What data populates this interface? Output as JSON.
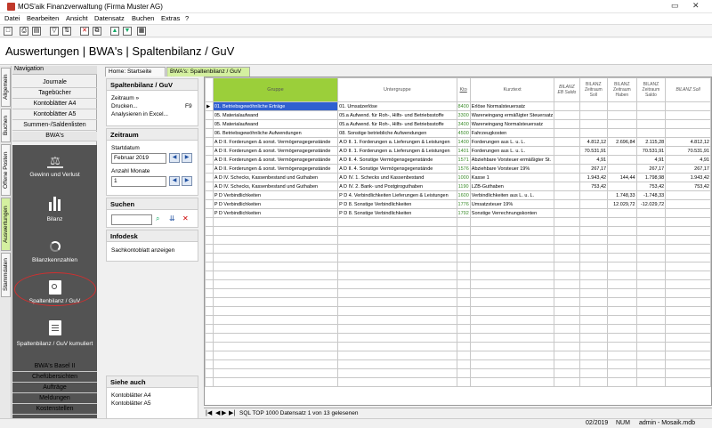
{
  "window": {
    "title": "MOS'aik Finanzverwaltung (Firma Muster AG)"
  },
  "menu": [
    "Datei",
    "Bearbeiten",
    "Ansicht",
    "Datensatz",
    "Buchen",
    "Extras",
    "?"
  ],
  "app_title": "Auswertungen | BWA's | Spaltenbilanz / GuV",
  "side_tabs": [
    "Allgemein",
    "Buchen",
    "Offene Posten",
    "Auswertungen",
    "Stammdaten"
  ],
  "nav": {
    "header": "Navigation",
    "top_items": [
      "Journale",
      "Tagebücher",
      "Kontoblätter A4",
      "Kontoblätter A5",
      "Summen-/Saldenlisten",
      "BWA's"
    ],
    "big_items": [
      "Gewinn und Verlust",
      "Bilanz",
      "Bilanzkennzahlen",
      "Spaltenbilanz / GuV",
      "Spaltenbilanz / GuV kumuliert"
    ],
    "bottom_items": [
      "BWA's Basel II",
      "Chefübersichten",
      "Aufträge",
      "Meldungen",
      "Kostenstellen"
    ]
  },
  "tabs": [
    "Home: Startseite",
    "BWA's: Spaltenbilanz / GuV"
  ],
  "panel": {
    "title": "Spaltenbilanz / GuV",
    "links": [
      "Zeitraum »",
      "Drucken...",
      "Analysieren in Excel..."
    ],
    "shortcut": "F9",
    "zeitraum": {
      "title": "Zeitraum",
      "start_label": "Startdatum",
      "start_value": "Februar 2019",
      "months_label": "Anzahl Monate",
      "months_value": "1"
    },
    "suchen": {
      "title": "Suchen",
      "value": ""
    },
    "infodesk": {
      "title": "Infodesk",
      "link": "Sachkontoblatt anzeigen"
    },
    "siehe": {
      "title": "Siehe auch",
      "links": [
        "Kontoblätter A4",
        "Kontoblätter A5"
      ]
    }
  },
  "grid": {
    "headers": [
      "Gruppe",
      "Untergruppe",
      "Kto",
      "Kurztext",
      "BILANZ EB Saldo",
      "BILANZ Zeitraum Soll",
      "BILANZ Zeitraum Haben",
      "BILANZ Zeitraum Saldo",
      "BILANZ Soll"
    ],
    "rows": [
      [
        "01. Betriebsgewöhnliche Erträge",
        "01. Umsatzerlöse",
        "8400",
        "Erlöse Normalsteuersatz",
        "",
        "",
        "",
        "",
        ""
      ],
      [
        "05. Materialaufwand",
        "05.a Aufwend. für Roh-, Hilfs- und Betriebsstoffe",
        "3300",
        "Wareneingang ermäßigter Steuersatz",
        "",
        "",
        "",
        "",
        ""
      ],
      [
        "05. Materialaufwand",
        "05.a Aufwend. für Roh-, Hilfs- und Betriebsstoffe",
        "3400",
        "Wareneingang Normalsteuersatz",
        "",
        "",
        "",
        "",
        ""
      ],
      [
        "06. Betriebsgewöhnliche Aufwendungen",
        "08. Sonstige betriebliche Aufwendungen",
        "4500",
        "Fahrzeugkosten",
        "",
        "",
        "",
        "",
        ""
      ],
      [
        "A D II. Forderungen & sonst. Vermögensgegenstände",
        "A D II. 1. Forderungen a. Lieferungen & Leistungen",
        "1400",
        "Forderungen aus L. u. L.",
        "",
        "4.812,12",
        "2.696,84",
        "2.115,28",
        "4.812,12"
      ],
      [
        "A D II. Forderungen & sonst. Vermögensgegenstände",
        "A D II. 1. Forderungen a. Lieferungen & Leistungen",
        "1401",
        "Forderungen aus L. u. L.",
        "",
        "70.531,91",
        "",
        "70.531,91",
        "70.531,91"
      ],
      [
        "A D II. Forderungen & sonst. Vermögensgegenstände",
        "A D II. 4. Sonstige Vermögensgegenstände",
        "1571",
        "Abziehbare Vorsteuer ermäßigter St.",
        "",
        "4,91",
        "",
        "4,91",
        "4,91"
      ],
      [
        "A D II. Forderungen & sonst. Vermögensgegenstände",
        "A D II. 4. Sonstige Vermögensgegenstände",
        "1576",
        "Abziehbare Vorsteuer 19%",
        "",
        "267,17",
        "",
        "267,17",
        "267,17"
      ],
      [
        "A D IV. Schecks, Kassenbestand und Guthaben",
        "A D IV. 1. Schecks und Kassenbestand",
        "1000",
        "Kasse 1",
        "",
        "1.943,42",
        "144,44",
        "1.798,98",
        "1.943,42"
      ],
      [
        "A D IV. Schecks, Kassenbestand und Guthaben",
        "A D IV. 2. Bank- und Postgiroguthaben",
        "1190",
        "LZB-Guthaben",
        "",
        "753,42",
        "",
        "753,42",
        "753,42"
      ],
      [
        "P D Verbindlichkeiten",
        "P D 4. Verbindlichkeiten Lieferungen & Leistungen",
        "1600",
        "Verbindlichkeiten aus L. u. L.",
        "",
        "",
        "1.748,33",
        "-1.748,33",
        ""
      ],
      [
        "P D Verbindlichkeiten",
        "P D 8. Sonstige Verbindlichkeiten",
        "1776",
        "Umsatzsteuer 19%",
        "",
        "",
        "12.029,72",
        "-12.029,72",
        ""
      ],
      [
        "P D Verbindlichkeiten",
        "P D 8. Sonstige Verbindlichkeiten",
        "1792",
        "Sonstige Verrechnungskonten",
        "",
        "",
        "",
        "",
        ""
      ]
    ]
  },
  "record_nav": "SQL TOP 1000 Datensatz 1 von 13 gelesenen",
  "status": {
    "period": "02/2019",
    "num": "NUM",
    "user": "admin - Mosaik.mdb"
  },
  "colors": {
    "accent_green": "#9bcf3a",
    "dark_nav": "#535353",
    "highlight": "#d03030"
  }
}
